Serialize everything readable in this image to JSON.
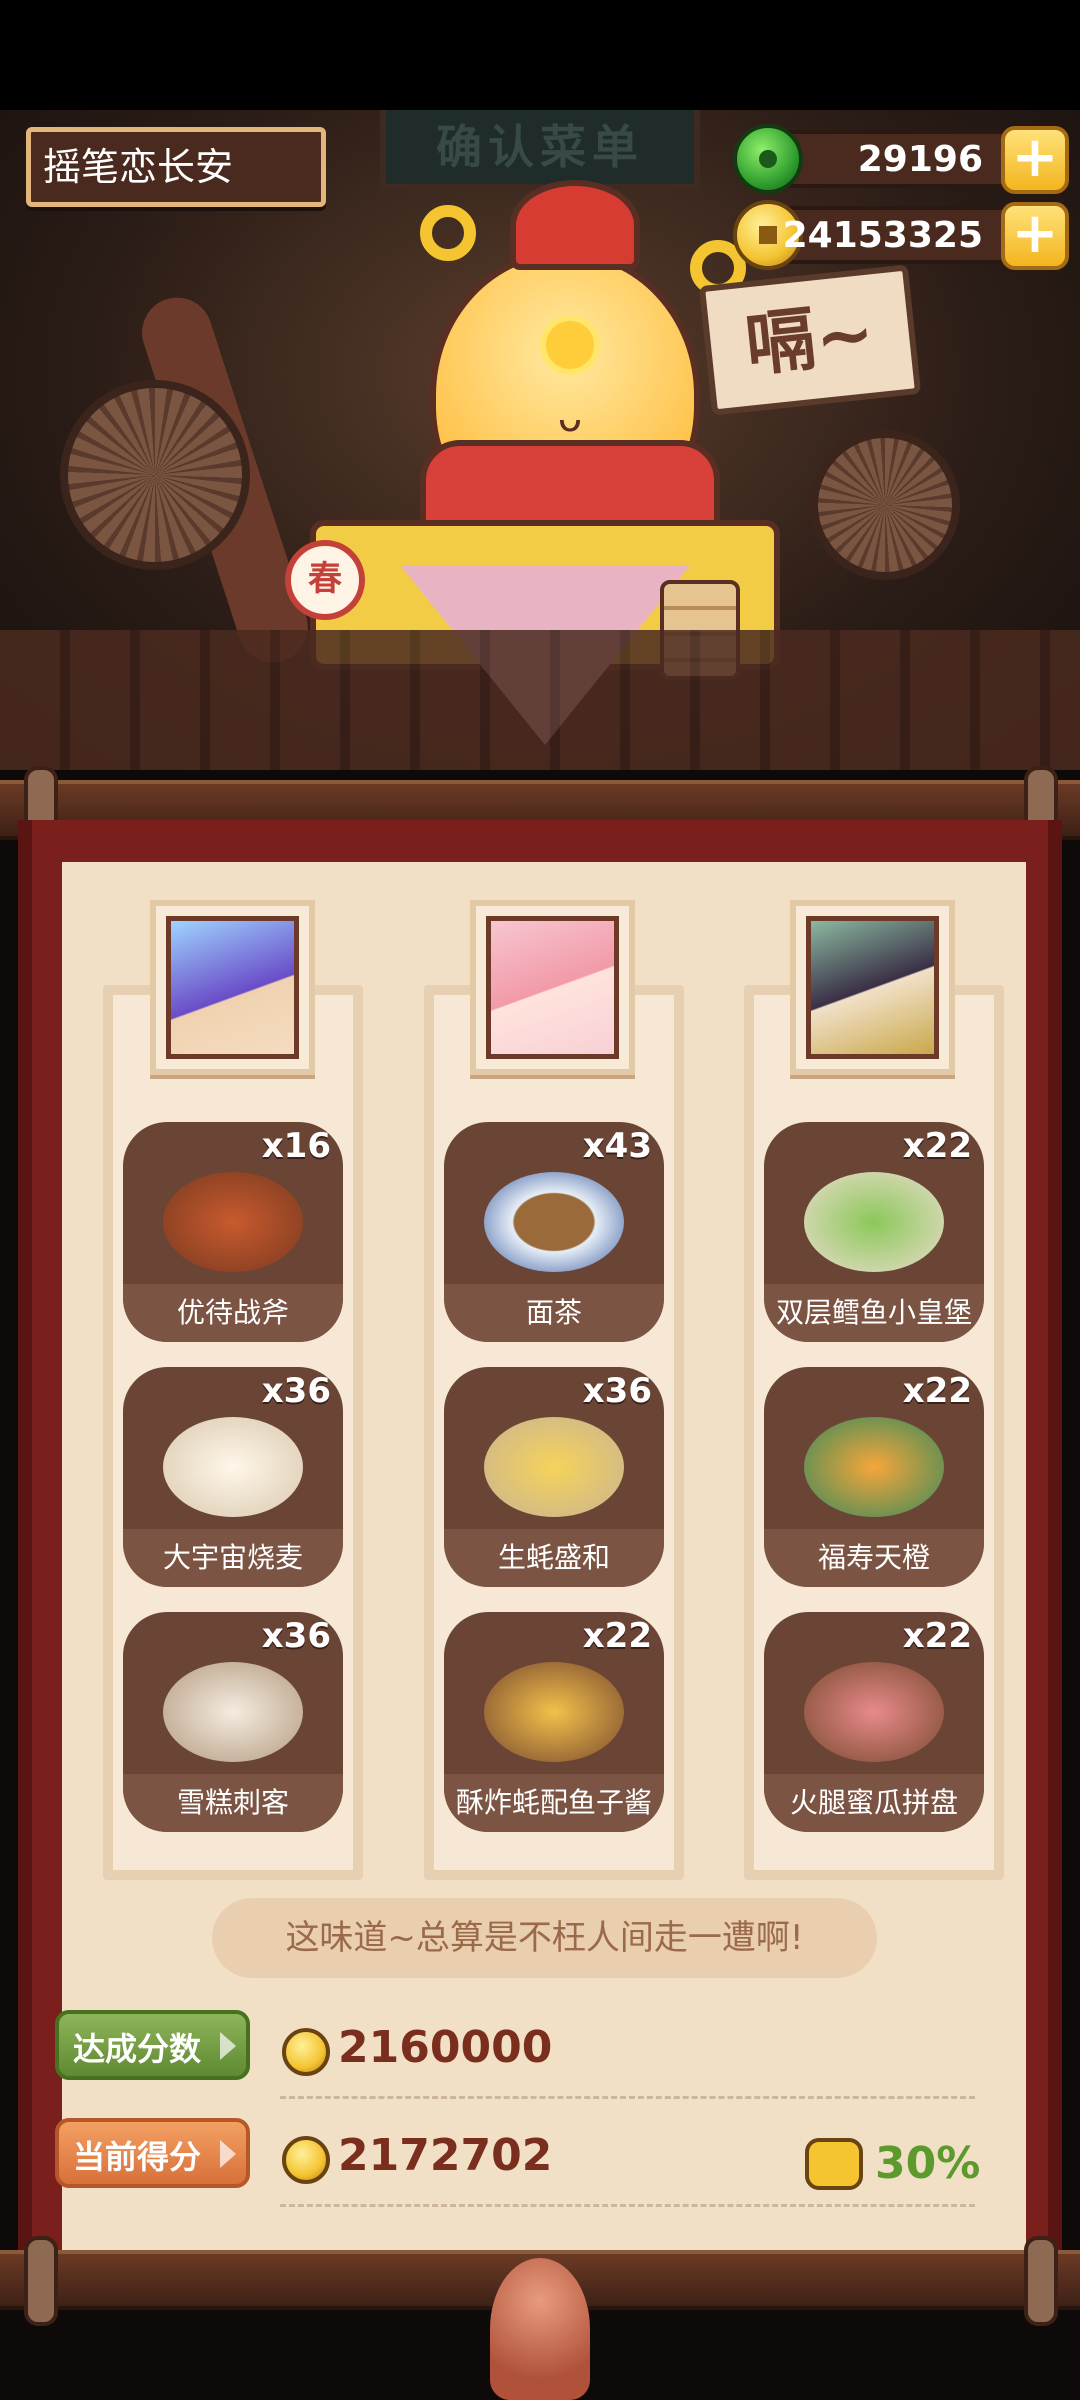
{
  "header": {
    "player_name": "摇笔恋长安",
    "sign_text": "确认菜单",
    "currencies": [
      {
        "icon": "jade-icon",
        "value": "29196",
        "add_icon": "plus-icon"
      },
      {
        "icon": "gold-coin-icon",
        "value": "24153325",
        "add_icon": "plus-icon"
      }
    ],
    "speech": "嗝~",
    "drum_char": "春"
  },
  "menu": {
    "columns": [
      {
        "portrait": "character-portrait-1",
        "dishes": [
          {
            "name": "优待战斧",
            "qty": "x16"
          },
          {
            "name": "大宇宙烧麦",
            "qty": "x36"
          },
          {
            "name": "雪糕刺客",
            "qty": "x36"
          }
        ]
      },
      {
        "portrait": "character-portrait-2",
        "dishes": [
          {
            "name": "面茶",
            "qty": "x43"
          },
          {
            "name": "生蚝盛和",
            "qty": "x36"
          },
          {
            "name": "酥炸蚝配鱼子酱",
            "qty": "x22"
          }
        ]
      },
      {
        "portrait": "character-portrait-3",
        "dishes": [
          {
            "name": "双层鳕鱼小皇堡",
            "qty": "x22"
          },
          {
            "name": "福寿天橙",
            "qty": "x22"
          },
          {
            "name": "火腿蜜瓜拼盘",
            "qty": "x22"
          }
        ]
      }
    ],
    "quote": "这味道~总算是不枉人间走一遭啊!"
  },
  "scores": {
    "target_label": "达成分数",
    "target_value": "2160000",
    "current_label": "当前得分",
    "current_value": "2172702",
    "bonus_percent": "30%"
  },
  "colors": {
    "panel_red": "#7a1f1b",
    "paper": "#f2e0c6",
    "dish_bg": "#6a4536",
    "score_red": "#7a2e1e",
    "bonus_green": "#5c9a2e"
  }
}
